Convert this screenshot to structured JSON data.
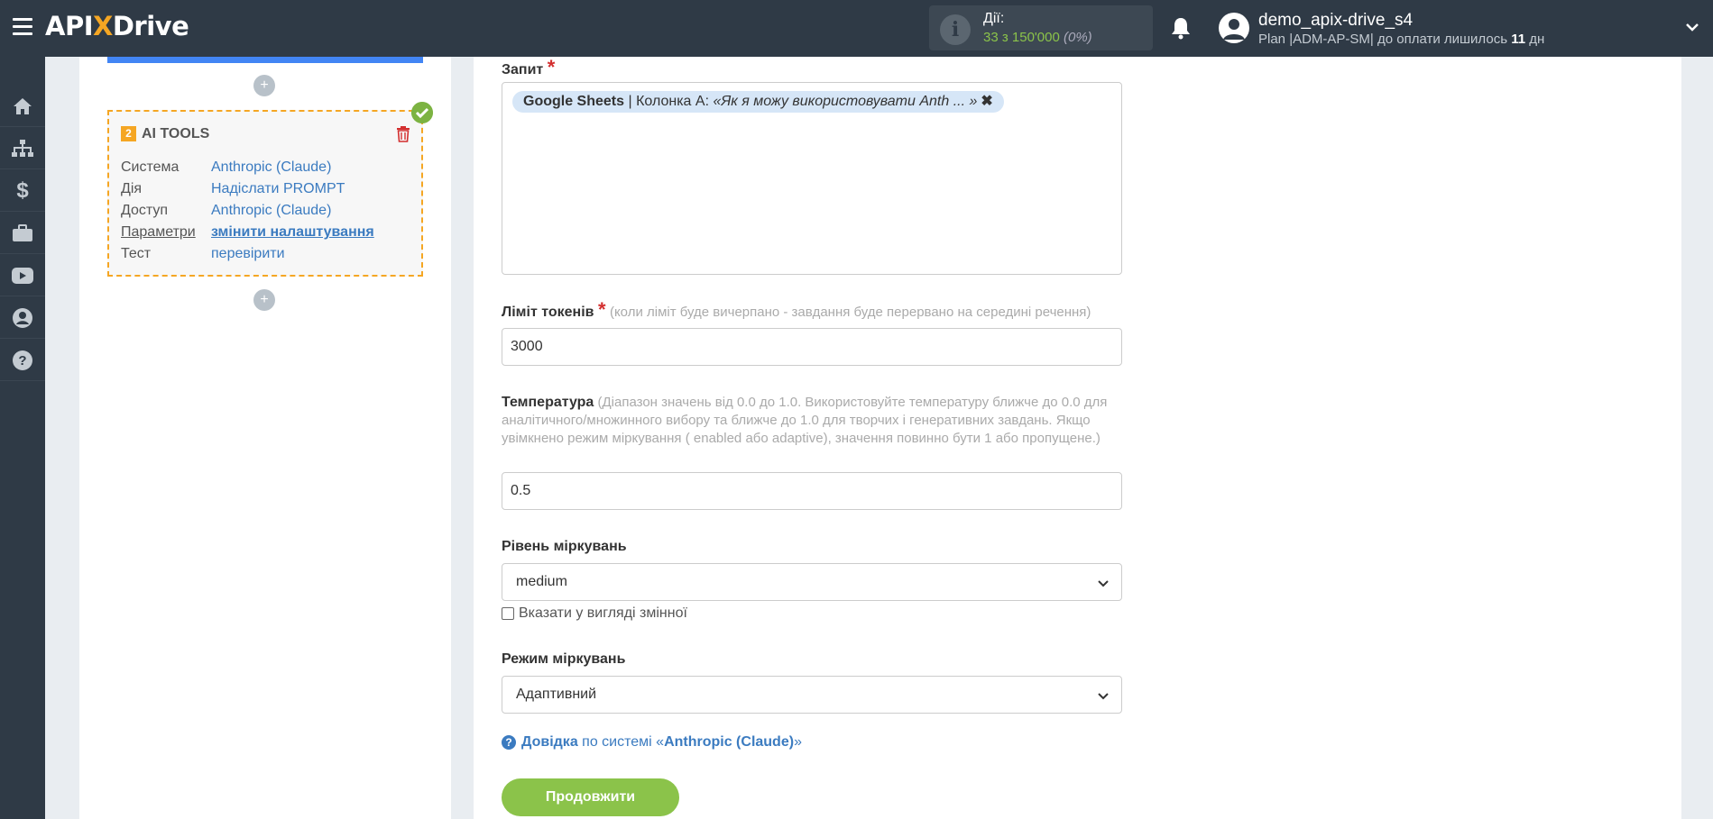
{
  "header": {
    "logo_a": "API",
    "logo_x": "X",
    "logo_b": "Drive",
    "actions_label": "Дії:",
    "actions_value": "33 з 150'000",
    "actions_percent": "(0%)",
    "username": "demo_apix-drive_s4",
    "plan_prefix": "Plan |ADM-AP-SM| до оплати лишилось",
    "plan_days": "11",
    "plan_suffix": "дн"
  },
  "nav": [
    "home-icon",
    "sitemap-icon",
    "dollar-icon",
    "briefcase-icon",
    "youtube-icon",
    "user-icon",
    "question-icon"
  ],
  "card": {
    "number": "2",
    "title": "AI TOOLS",
    "rows": [
      {
        "key": "Система",
        "value": "Anthropic (Claude)"
      },
      {
        "key": "Дія",
        "value": "Надіслати PROMPT"
      },
      {
        "key": "Доступ",
        "value": "Anthropic (Claude)"
      },
      {
        "key": "Параметри",
        "value": "змінити налаштування"
      },
      {
        "key": "Тест",
        "value": "перевірити"
      }
    ]
  },
  "form": {
    "query_label": "Запит",
    "query_tag_source": "Google Sheets",
    "query_tag_column": "| Колонка А:",
    "query_tag_value": "«Як я можу використовувати Anth ... »",
    "tokens_label": "Ліміт токенів",
    "tokens_hint": "(коли ліміт буде вичерпано - завдання буде перервано на середині речення)",
    "tokens_value": "3000",
    "temperature_label": "Температура",
    "temperature_hint": "(Діапазон значень від 0.0 до 1.0. Використовуйте температуру ближче до 0.0 для аналітичного/множинного вибору та ближче до 1.0 для творчих і генеративних завдань. Якщо увімкнено режим міркування ( enabled або adaptive), значення повинно бути 1 або пропущене.)",
    "temperature_value": "0.5",
    "reasoning_level_label": "Рівень міркувань",
    "reasoning_level_value": "medium",
    "as_variable_label": "Вказати у вигляді змінної",
    "reasoning_mode_label": "Режим міркувань",
    "reasoning_mode_value": "Адаптивний",
    "help_bold": "Довідка",
    "help_text": "по системі «",
    "help_system": "Anthropic (Claude)",
    "help_end": "»",
    "continue_label": "Продовжити"
  },
  "colors": {
    "topbar": "#2f3a46",
    "accent_orange": "#f5a623",
    "link_blue": "#3b7bc0",
    "button_green": "#8bc34a"
  }
}
